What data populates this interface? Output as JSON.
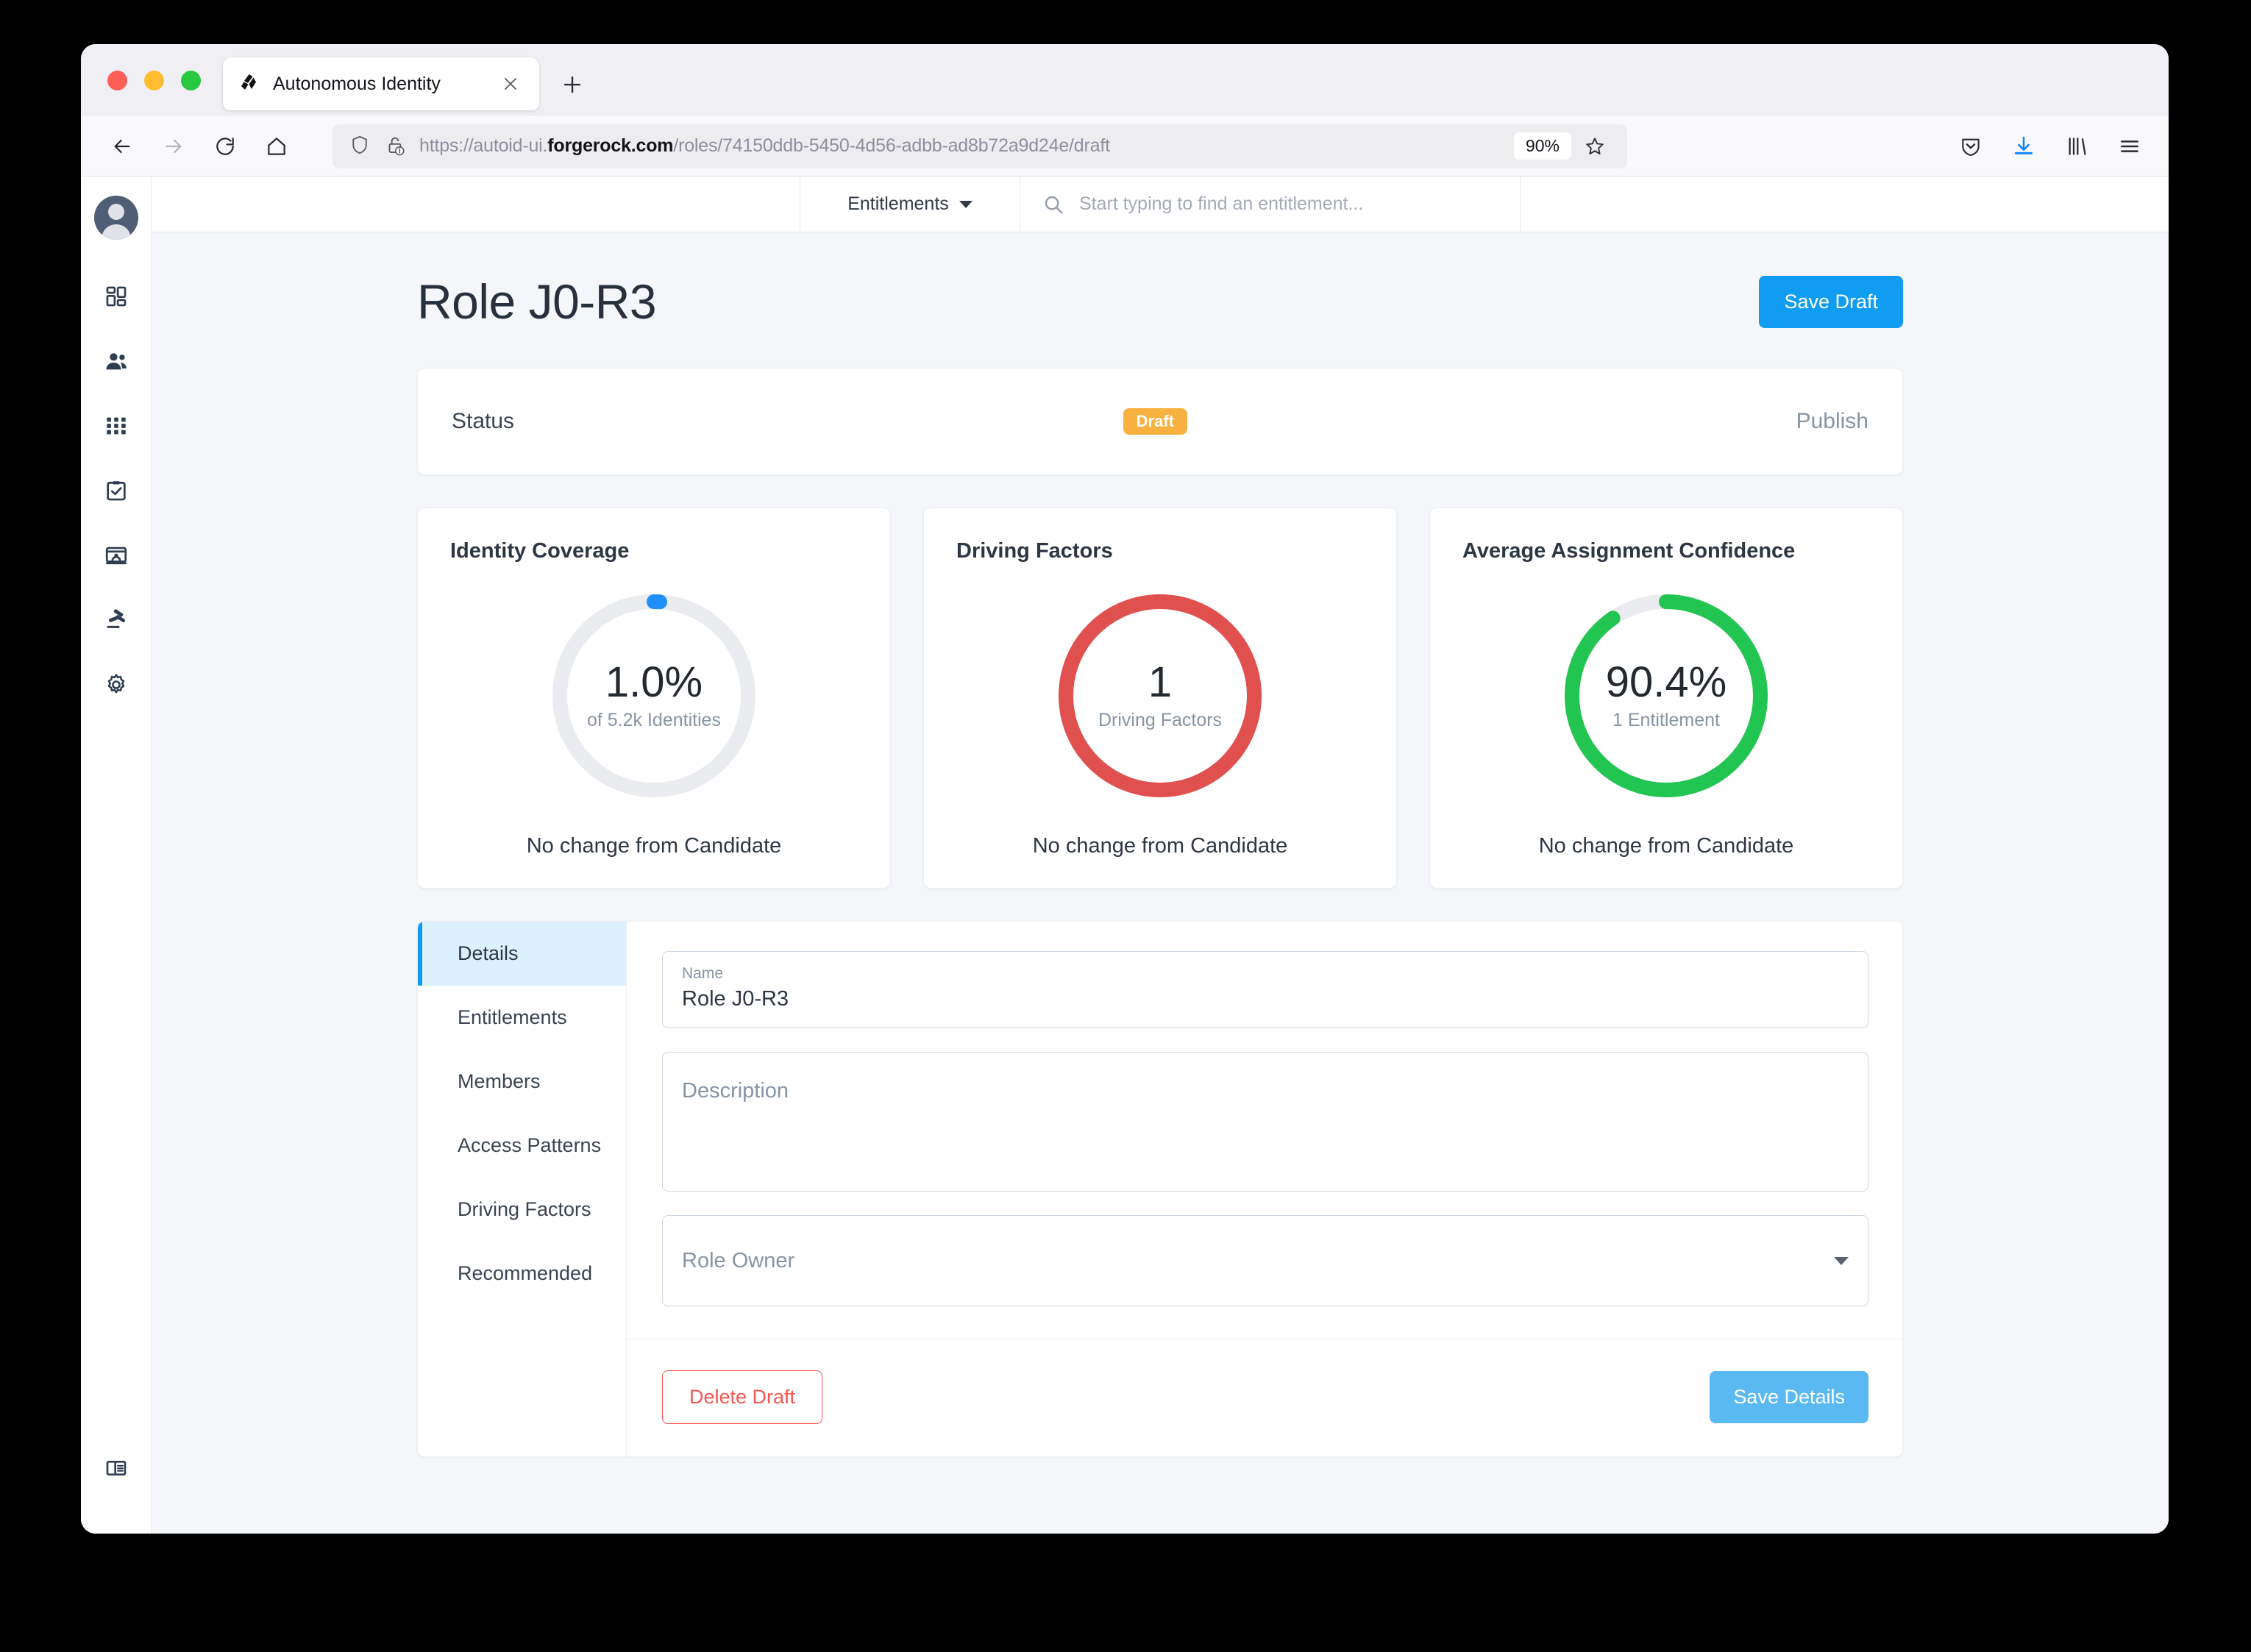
{
  "browser": {
    "tab": {
      "title": "Autonomous Identity",
      "favicon": "forgerock-logo-icon",
      "close": "×"
    },
    "new_tab_label": "+",
    "url": {
      "prefix": "https://autoid-ui.",
      "domain": "forgerock.com",
      "suffix": "/roles/74150ddb-5450-4d56-adbb-ad8b72a9d24e/draft",
      "full": "https://autoid-ui.forgerock.com/roles/74150ddb-5450-4d56-adbb-ad8b72a9d24e/draft"
    },
    "zoom_level": "90%",
    "icons": {
      "back": "back-arrow-icon",
      "forward": "forward-arrow-icon",
      "reload": "reload-icon",
      "home": "home-icon",
      "shield": "tracking-protection-shield-icon",
      "lock_warning": "insecure-lock-icon",
      "star": "bookmark-star-icon",
      "pocket": "pocket-save-icon",
      "download": "download-icon",
      "library": "library-icon",
      "menu": "hamburger-menu-icon"
    }
  },
  "sidebar": {
    "avatar": "user-avatar",
    "items": [
      {
        "icon": "dashboard-grid-icon",
        "name": "dashboard"
      },
      {
        "icon": "people-icon",
        "name": "identities"
      },
      {
        "icon": "apps-grid-icon",
        "name": "applications"
      },
      {
        "icon": "clipboard-check-icon",
        "name": "certifications"
      },
      {
        "icon": "id-card-icon",
        "name": "entitlements"
      },
      {
        "icon": "gavel-icon",
        "name": "rules"
      },
      {
        "icon": "gear-icon",
        "name": "settings"
      }
    ],
    "toggle": {
      "icon": "sidebar-toggle-icon",
      "name": "collapse-sidebar"
    }
  },
  "appheader": {
    "scope_select": {
      "label": "Entitlements",
      "caret": "chevron-down-icon"
    },
    "search": {
      "icon": "search-icon",
      "placeholder": "Start typing to find an entitlement...",
      "value": ""
    }
  },
  "page": {
    "title": "Role J0-R3",
    "save_draft_label": "Save Draft"
  },
  "status": {
    "label": "Status",
    "badge": "Draft",
    "badge_color": "#f7b140",
    "publish_label": "Publish"
  },
  "metrics": [
    {
      "title": "Identity Coverage",
      "value": "1.0%",
      "sub": "of 5.2k Identities",
      "footer": "No change from Candidate",
      "percent": 1.0,
      "color": "#1f8ffb",
      "track": "#eaecef"
    },
    {
      "title": "Driving Factors",
      "value": "1",
      "sub": "Driving Factors",
      "footer": "No change from Candidate",
      "percent": 100,
      "color": "#e0504f",
      "track": "#eaecef"
    },
    {
      "title": "Average Assignment Confidence",
      "value": "90.4%",
      "sub": "1 Entitlement",
      "footer": "No change from Candidate",
      "percent": 90.4,
      "color": "#23c552",
      "track": "#eaecef"
    }
  ],
  "details": {
    "tabs": [
      {
        "label": "Details",
        "active": true
      },
      {
        "label": "Entitlements",
        "active": false
      },
      {
        "label": "Members",
        "active": false
      },
      {
        "label": "Access Patterns",
        "active": false
      },
      {
        "label": "Driving Factors",
        "active": false
      },
      {
        "label": "Recommended",
        "active": false
      }
    ],
    "name_field": {
      "label": "Name",
      "value": "Role J0-R3"
    },
    "description_field": {
      "placeholder": "Description",
      "value": ""
    },
    "role_owner_field": {
      "placeholder": "Role Owner",
      "value": "",
      "caret": "chevron-down-icon"
    },
    "delete_label": "Delete Draft",
    "save_label": "Save Details"
  },
  "chart_data": {
    "type": "pie",
    "title": "Role metric donut gauges",
    "charts": [
      {
        "name": "Identity Coverage",
        "value": 1.0,
        "max": 100,
        "unit": "%",
        "color": "#1f8ffb",
        "annotation": "of 5.2k Identities"
      },
      {
        "name": "Driving Factors",
        "value": 1,
        "max": 1,
        "unit": "count",
        "color": "#e0504f",
        "annotation": "Driving Factors"
      },
      {
        "name": "Average Assignment Confidence",
        "value": 90.4,
        "max": 100,
        "unit": "%",
        "color": "#23c552",
        "annotation": "1 Entitlement"
      }
    ]
  }
}
